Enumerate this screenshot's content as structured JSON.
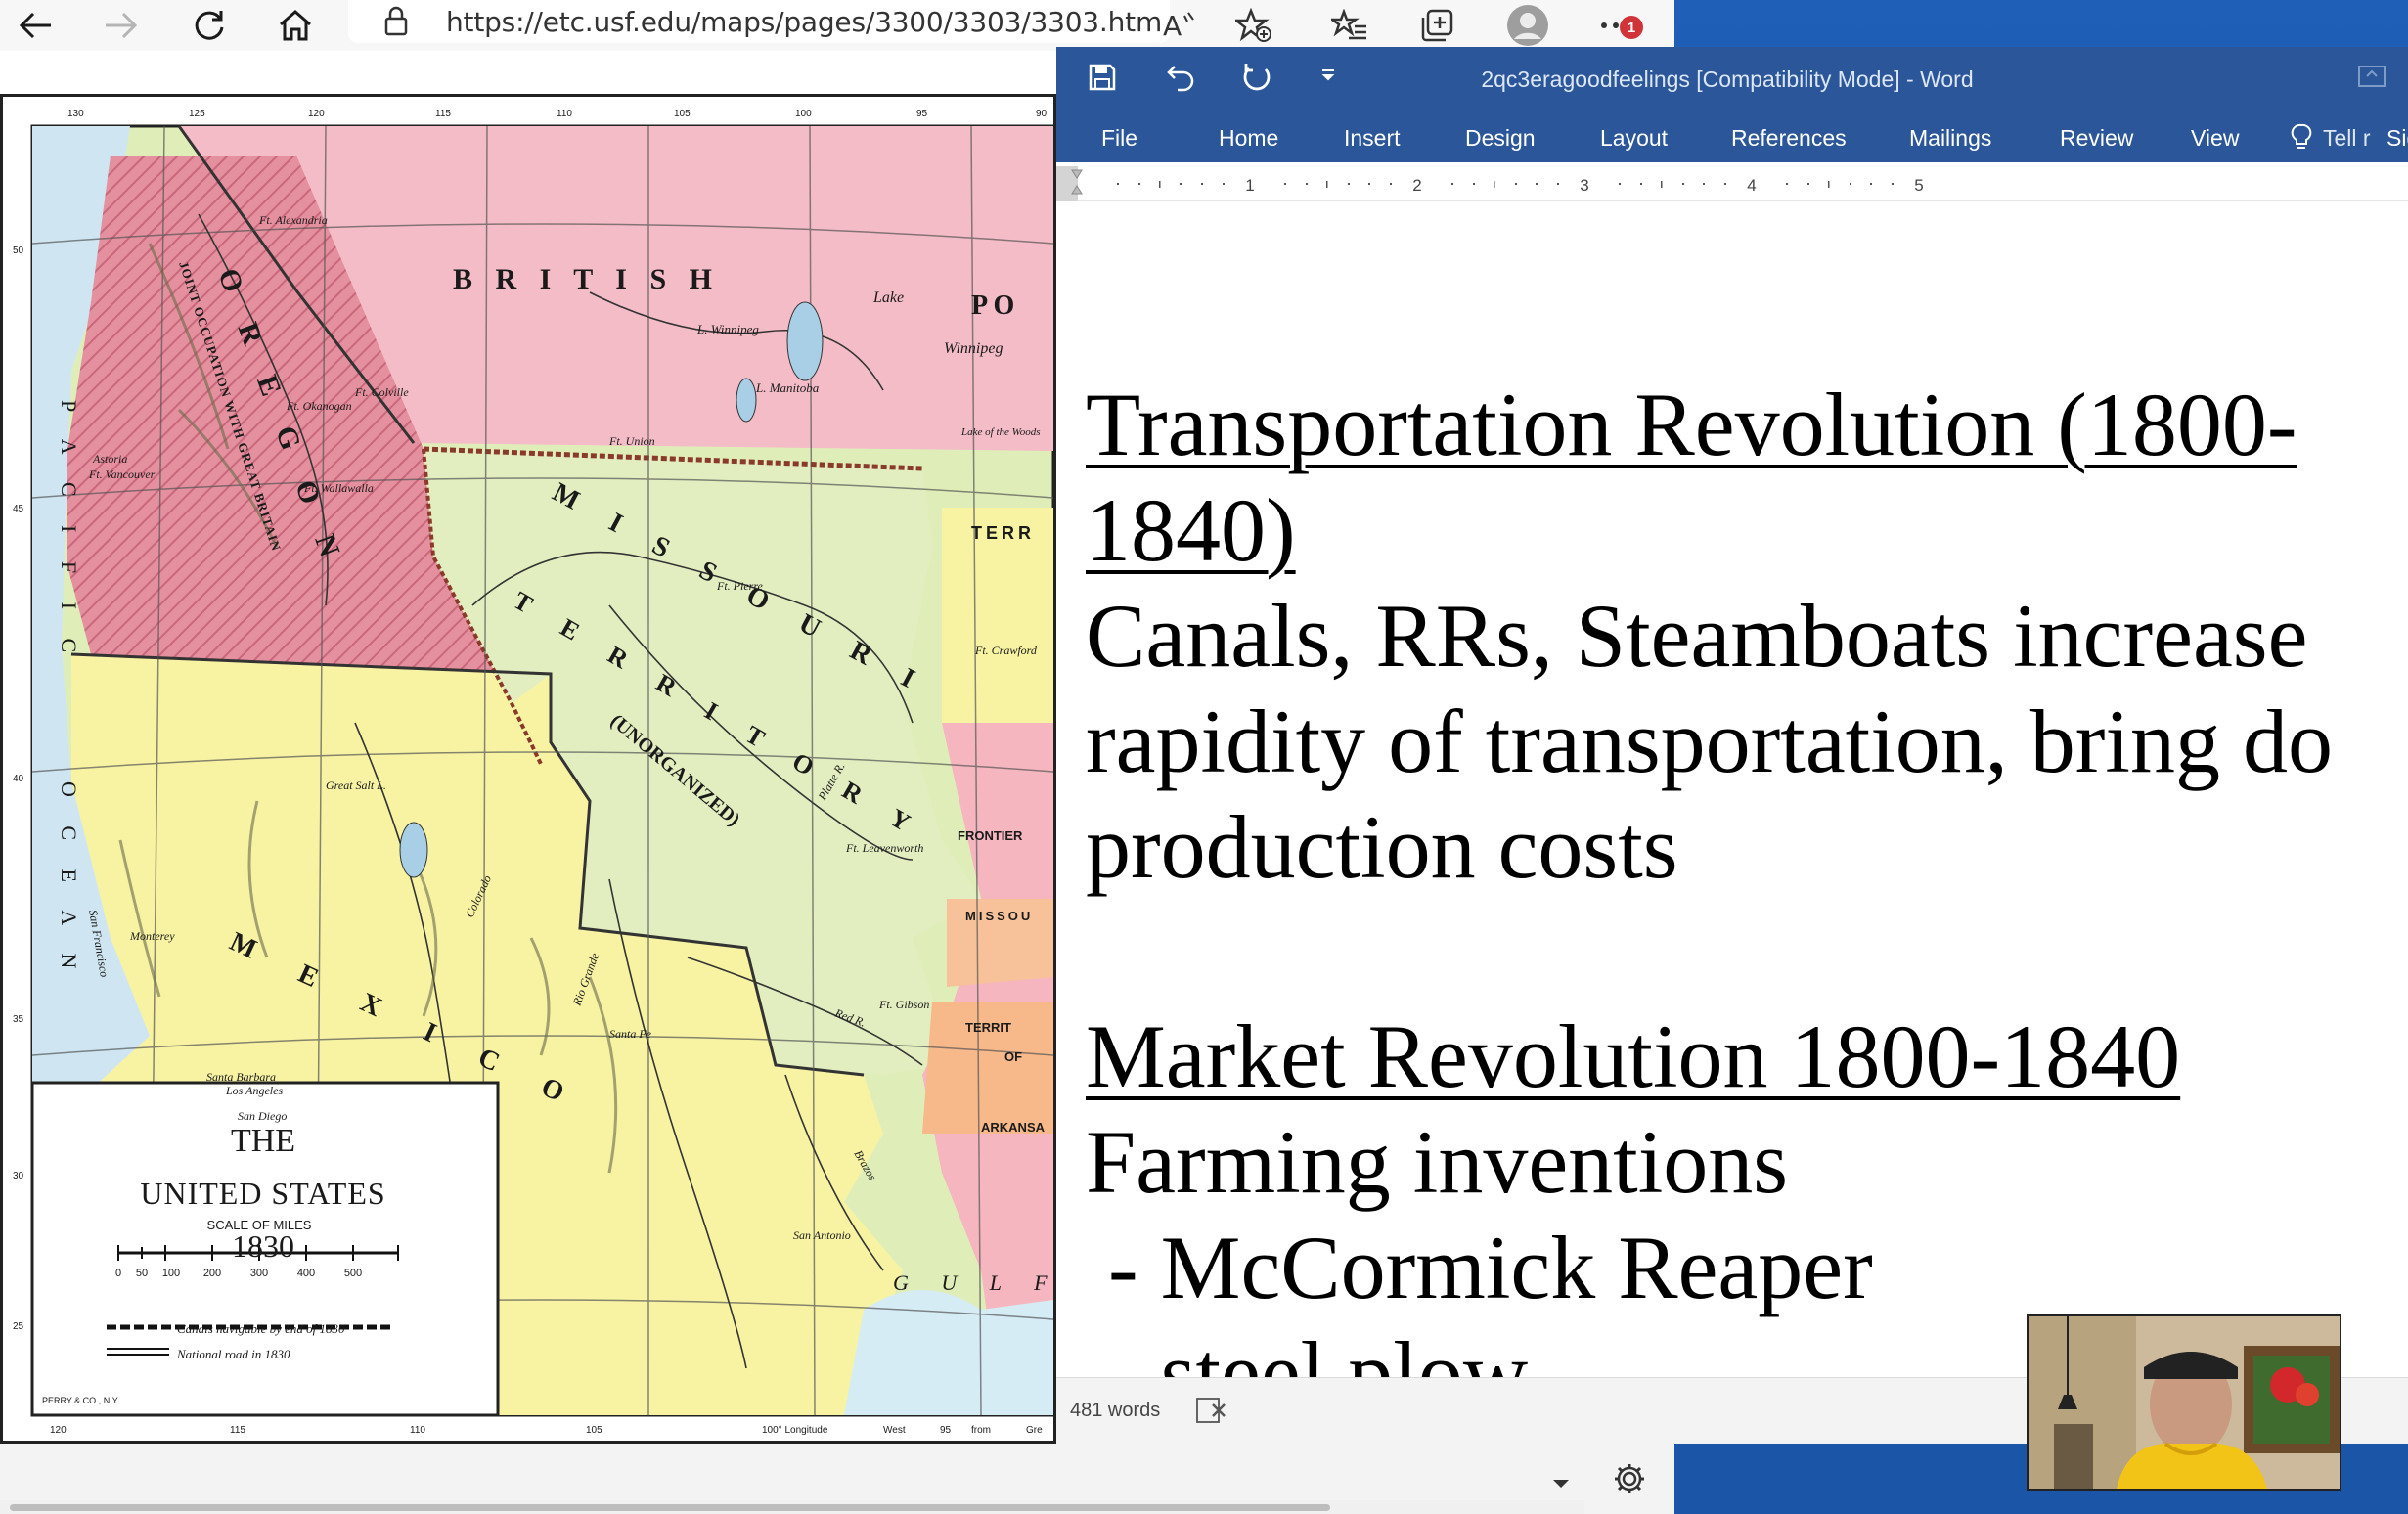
{
  "browser": {
    "url": "https://etc.usf.edu/maps/pages/3300/3303/3303.htm",
    "notification_count": "1"
  },
  "map": {
    "title_line1": "THE",
    "title_line2": "UNITED STATES",
    "title_line3": "1830",
    "scale_title": "SCALE OF MILES",
    "scale_ticks": [
      "0",
      "50",
      "100",
      "200",
      "300",
      "400",
      "500"
    ],
    "legend_canals": "Canals navigable by end of 1830",
    "legend_road": "National road in 1830",
    "publisher": "PERRY & CO., N.Y.",
    "labels": {
      "british": "B R I T I S H",
      "oregon": "O R E G O N",
      "pacific": "P A C I F I C",
      "ocean": "O C E A N",
      "missouri_territory": "M I S S O U R I",
      "territory": "T E R R I T O R Y",
      "unorganized": "(UNORGANIZED)",
      "mexico": "M E X I C O",
      "gulf": "G U L F",
      "joint_occupation": "JOINT OCCUPATION WITH GREAT BRITAIN",
      "great_salt_lake": "Great Salt L.",
      "lake_winnipeg": "L. Winnipeg",
      "winnipeg": "Winnipeg",
      "lake_manitoba": "L. Manitoba",
      "lake_of_woods": "Lake of the Woods",
      "ft_union": "Ft. Union",
      "ft_pierre": "Ft. Pierre",
      "ft_leavenworth": "Ft. Leavenworth",
      "ft_gibson": "Ft. Gibson",
      "ft_crawford": "Ft. Crawford",
      "ft_vancouver": "Ft. Vancouver",
      "ft_walla_walla": "Ft. Wallawalla",
      "ft_colville": "Ft. Colville",
      "ft_okanogan": "Ft. Okanogan",
      "ft_alexandria": "Ft. Alexandria",
      "astoria": "Astoria",
      "san_francisco": "San Francisco",
      "monterey": "Monterey",
      "santa_barbara": "Santa Barbara",
      "los_angeles": "Los Angeles",
      "san_diego": "San Diego",
      "santa_fe": "Santa Fe",
      "san_antonio": "San Antonio",
      "frontier": "FRONTIER",
      "missou": "MISSOU",
      "territ": "TERRIT",
      "of": "OF",
      "arkansa": "ARKANSA",
      "terr": "TERR",
      "platte_r": "Platte R.",
      "red_r": "Red R.",
      "colorado": "Colorado",
      "rio_grande": "Rio Grande",
      "brazos": "Brazos",
      "lake": "Lake",
      "p_o": "P O"
    },
    "lat_ticks": [
      "50",
      "45",
      "40",
      "35",
      "30",
      "25"
    ],
    "lon_ticks_top": [
      "130",
      "125",
      "120",
      "115",
      "110",
      "105",
      "100",
      "95",
      "90"
    ],
    "lon_bottom": [
      "120",
      "115",
      "110",
      "105",
      "100° Longitude",
      "West",
      "95",
      "from",
      "Gre"
    ]
  },
  "word": {
    "title": "2qc3eragoodfeelings [Compatibility Mode] - Word",
    "tabs": [
      "File",
      "Home",
      "Insert",
      "Design",
      "Layout",
      "References",
      "Mailings",
      "Review",
      "View"
    ],
    "tell_me": "Tell r",
    "sign_in": "Sig",
    "ruler_numbers": [
      "1",
      "2",
      "3",
      "4",
      "5"
    ],
    "doc": {
      "h1_line1": "Transportation Revolution (1800-",
      "h1_line2": "1840)",
      "p1_line1": "Canals, RRs, Steamboats increase",
      "p1_line2": "rapidity of transportation, bring do",
      "p1_line3": "production costs",
      "h2": "Market Revolution 1800-1840",
      "p2_line1": "Farming inventions",
      "p2_line2": " - McCormick Reaper",
      "p2_line3": " - steel plow"
    },
    "word_count": "481 words"
  },
  "colors": {
    "word_blue": "#2b579a",
    "desktop_blue": "#1a56a8",
    "map_pink": "#f2b8c4",
    "map_oregon": "#e58a9c",
    "map_green": "#dfeeb8",
    "map_yellow": "#f7f2a2"
  }
}
